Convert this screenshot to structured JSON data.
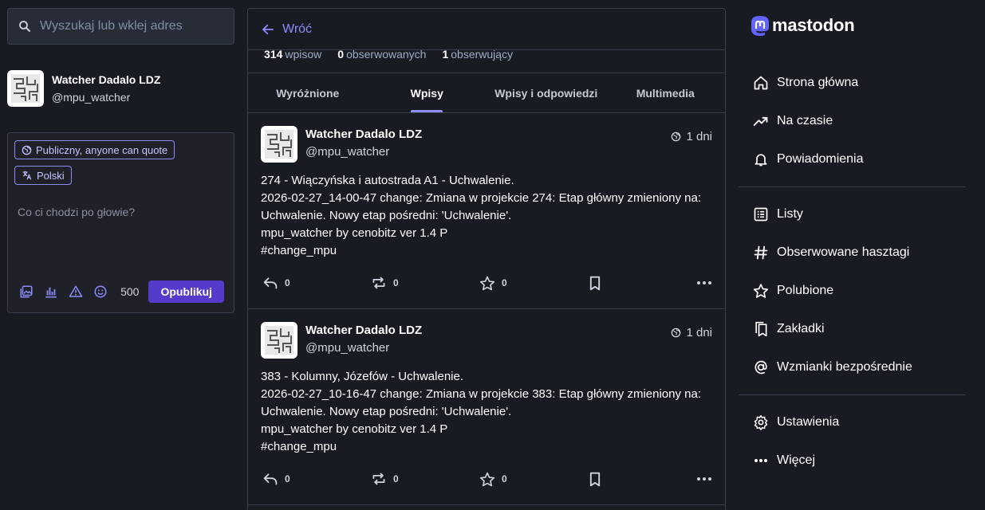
{
  "search": {
    "placeholder": "Wyszukaj lub wklej adres"
  },
  "account": {
    "display_name": "Watcher Dadalo LDZ",
    "handle": "@mpu_watcher"
  },
  "compose": {
    "visibility_label": "Publiczny, anyone can quote",
    "language_label": "Polski",
    "placeholder": "Co ci chodzi po głowie?",
    "char_count": "500",
    "publish_label": "Opublikuj"
  },
  "header": {
    "back_label": "Wróć"
  },
  "profile_stats": [
    {
      "value": "314",
      "label": "wpisow"
    },
    {
      "value": "0",
      "label": "obserwowanych"
    },
    {
      "value": "1",
      "label": "obserwujący"
    }
  ],
  "tabs": [
    {
      "label": "Wyróżnione"
    },
    {
      "label": "Wpisy"
    },
    {
      "label": "Wpisy i odpowiedzi"
    },
    {
      "label": "Multimedia"
    }
  ],
  "posts": [
    {
      "display_name": "Watcher Dadalo LDZ",
      "handle": "@mpu_watcher",
      "time": "1 dni",
      "lines": [
        "274 - Wiączyńska i autostrada A1 - Uchwalenie.",
        "2026-02-27_14-00-47 change: Zmiana w projekcie 274: Etap główny zmieniony na: Uchwalenie. Nowy etap pośredni: 'Uchwalenie'.",
        "mpu_watcher by cenobitz ver 1.4 P",
        "#change_mpu"
      ],
      "replies": "0",
      "boosts": "0",
      "favourites": "0"
    },
    {
      "display_name": "Watcher Dadalo LDZ",
      "handle": "@mpu_watcher",
      "time": "1 dni",
      "lines": [
        "383 - Kolumny, Józefów - Uchwalenie.",
        "2026-02-27_10-16-47 change: Zmiana w projekcie 383: Etap główny zmieniony na: Uchwalenie. Nowy etap pośredni: 'Uchwalenie'.",
        "mpu_watcher by cenobitz ver 1.4 P",
        "#change_mpu"
      ],
      "replies": "0",
      "boosts": "0",
      "favourites": "0"
    }
  ],
  "brand": {
    "name": "mastodon"
  },
  "nav": {
    "primary": [
      {
        "label": "Strona główna",
        "icon": "home-icon"
      },
      {
        "label": "Na czasie",
        "icon": "trending-icon"
      },
      {
        "label": "Powiadomienia",
        "icon": "bell-icon"
      }
    ],
    "secondary": [
      {
        "label": "Listy",
        "icon": "list-icon"
      },
      {
        "label": "Obserwowane hasztagi",
        "icon": "hashtag-icon"
      },
      {
        "label": "Polubione",
        "icon": "star-icon"
      },
      {
        "label": "Zakładki",
        "icon": "bookmarks-icon"
      },
      {
        "label": "Wzmianki bezpośrednie",
        "icon": "at-icon"
      }
    ],
    "tertiary": [
      {
        "label": "Ustawienia",
        "icon": "gear-icon"
      },
      {
        "label": "Więcej",
        "icon": "more-icon"
      }
    ]
  },
  "colors": {
    "background": "#191b22",
    "accent": "#8c8dff",
    "publish": "#563acc",
    "border": "#393f4f"
  }
}
